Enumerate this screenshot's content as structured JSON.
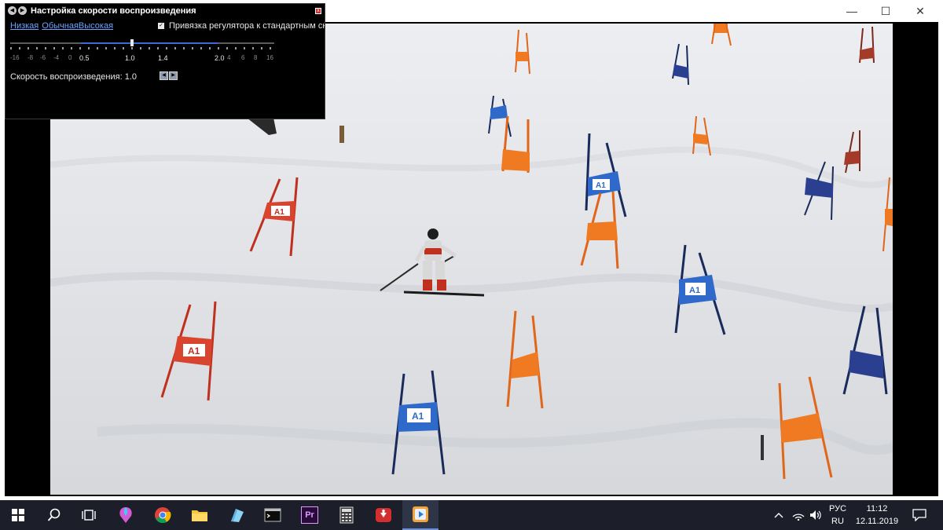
{
  "player": {
    "window_controls": {
      "minimize": "—",
      "maximize": "☐",
      "close": "✕"
    }
  },
  "speed_dialog": {
    "title": "Настройка скорости воспроизведения",
    "title_btn_back": "◀",
    "title_btn_forward": "▶",
    "close": "x",
    "presets": {
      "low": "Низкая",
      "normal": "Обычная",
      "high": "Высокая"
    },
    "snap_label": "Привязка регулятора к стандартным скоростям",
    "snap_checked_glyph": "✓",
    "slider": {
      "value": 1.0,
      "min_label": "-16",
      "max_label": "16"
    },
    "tick_labels": [
      "-16",
      "-8",
      "-6",
      "-4",
      "0",
      "0.5",
      "1.0",
      "1.4",
      "2.0",
      "4",
      "6",
      "8",
      "16"
    ],
    "speed_text": "Скорость воспроизведения: 1.0",
    "step_down": "◀",
    "step_up": "▶"
  },
  "video": {
    "sponsor_mark": "A1"
  },
  "taskbar": {
    "icons": [
      "windows-logo",
      "search",
      "task-view",
      "paint-3d",
      "chrome",
      "file-explorer",
      "photos",
      "terminal",
      "premiere-pro",
      "calculator",
      "downloader",
      "media-player"
    ],
    "premiere_label": "Pr",
    "lang_top": "РУС",
    "lang_bottom": "RU",
    "time": "11:12",
    "date": "12.11.2019"
  }
}
